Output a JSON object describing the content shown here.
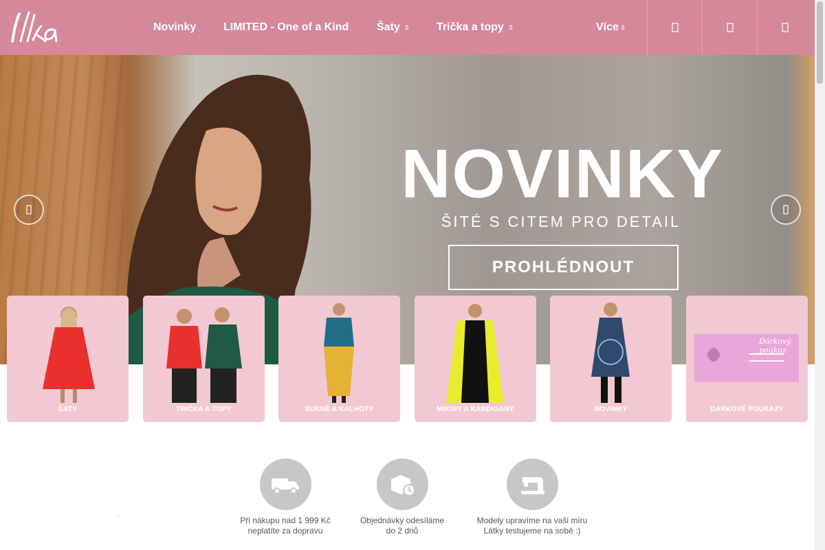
{
  "brand": {
    "logo_text": "Ilka"
  },
  "nav": {
    "items": [
      {
        "label": "Novinky",
        "has_caret": false
      },
      {
        "label": "LIMITED - One of a Kind",
        "has_caret": false
      },
      {
        "label": "Šaty",
        "has_caret": true
      },
      {
        "label": "Trička a topy",
        "has_caret": true
      }
    ],
    "more": {
      "label": "Více",
      "caret": "▯"
    },
    "icons": [
      "search-icon",
      "user-icon",
      "cart-icon"
    ],
    "caret_glyph": "▯"
  },
  "hero": {
    "title": "NOVINKY",
    "subtitle": "ŠITÉ S CITEM PRO DETAIL",
    "button": "PROHLÉDNOUT",
    "prev_icon": "chevron-left-icon",
    "next_icon": "chevron-right-icon"
  },
  "categories": [
    {
      "label": "ŠATY",
      "color": "#e8312f"
    },
    {
      "label": "TRIČKA A TOPY",
      "color": "#e8312f"
    },
    {
      "label": "SUKNĚ A KALHOTY",
      "color": "#e5b233"
    },
    {
      "label": "MIKINY A KARDIGANY",
      "color": "#e7ec2e"
    },
    {
      "label": "NOVINKY",
      "color": "#2f4a6e"
    },
    {
      "label": "DÁRKOVÉ POUKAZY",
      "color": "#e9a6d8"
    }
  ],
  "voucher": {
    "title": "Dárkový poukaz"
  },
  "features": [
    {
      "line1": "Při nákupu nad 1 999 Kč",
      "line2": "neplatíte za dopravu",
      "icon": "delivery-truck-icon"
    },
    {
      "line1": "Objednávky odesíláme",
      "line2": "do 2 dnů",
      "icon": "package-clock-icon"
    },
    {
      "line1": "Modely upravíme na vaši míru",
      "line2": "Látky testujeme na sobě :)",
      "icon": "sewing-machine-icon"
    }
  ],
  "colors": {
    "header": "#d48899",
    "card": "#f2c9d2",
    "feature_icon": "#c7c7c7"
  }
}
